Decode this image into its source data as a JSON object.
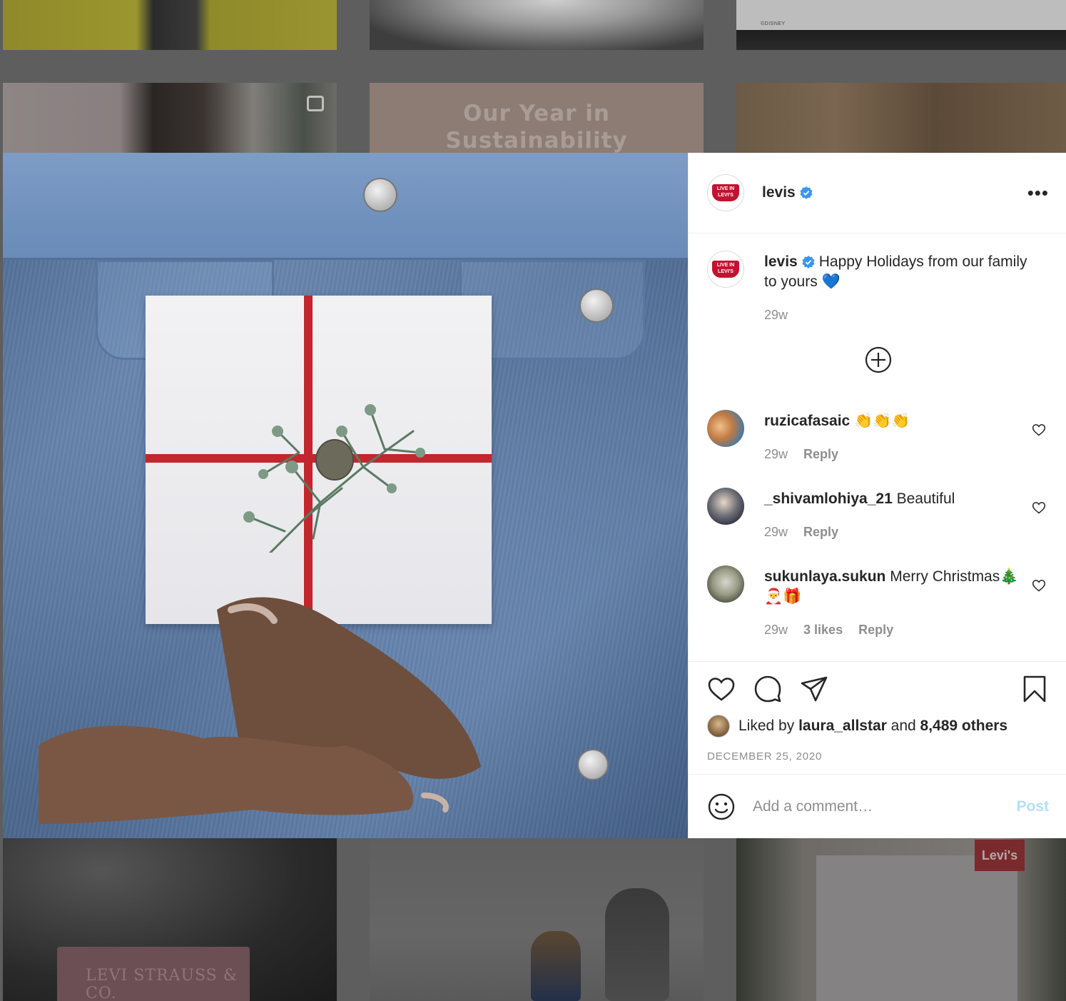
{
  "background_tiles": {
    "disney_credit": "©DISNEY",
    "sustainability_title": "Our Year in Sustainability",
    "patch_text": "LEVI STRAUSS & CO.",
    "levis_logo": "Levi's"
  },
  "post": {
    "username": "levis",
    "avatar_badge": "LIVE IN LEVI'S",
    "more_label": "•••",
    "caption": {
      "username": "levis",
      "text": "Happy Holidays from our family to yours 💙",
      "time": "29w"
    },
    "comments": [
      {
        "username": "ruzicafasaic",
        "text": "👏👏👏",
        "time": "29w",
        "likes": "",
        "reply": "Reply"
      },
      {
        "username": "_shivamlohiya_21",
        "text": "Beautiful",
        "time": "29w",
        "likes": "",
        "reply": "Reply"
      },
      {
        "username": "sukunlaya.sukun",
        "text": "Merry Christmas🎄🎅🎁",
        "time": "29w",
        "likes": "3 likes",
        "reply": "Reply"
      }
    ],
    "liked_by_prefix": "Liked by",
    "liked_by_user": "laura_allstar",
    "liked_by_and": "and",
    "liked_by_others": "8,489 others",
    "date": "DECEMBER 25, 2020",
    "comment_placeholder": "Add a comment…",
    "post_button": "Post"
  },
  "colors": {
    "verified": "#3897f0",
    "post_disabled": "#b2dffc",
    "meta_gray": "#8e8e8e",
    "ribbon": "#c1272d",
    "levis_red": "#c41230"
  },
  "icons": [
    "verified-icon",
    "more-icon",
    "add-circle-icon",
    "heart-icon",
    "comment-icon",
    "share-icon",
    "bookmark-icon",
    "emoji-icon"
  ]
}
